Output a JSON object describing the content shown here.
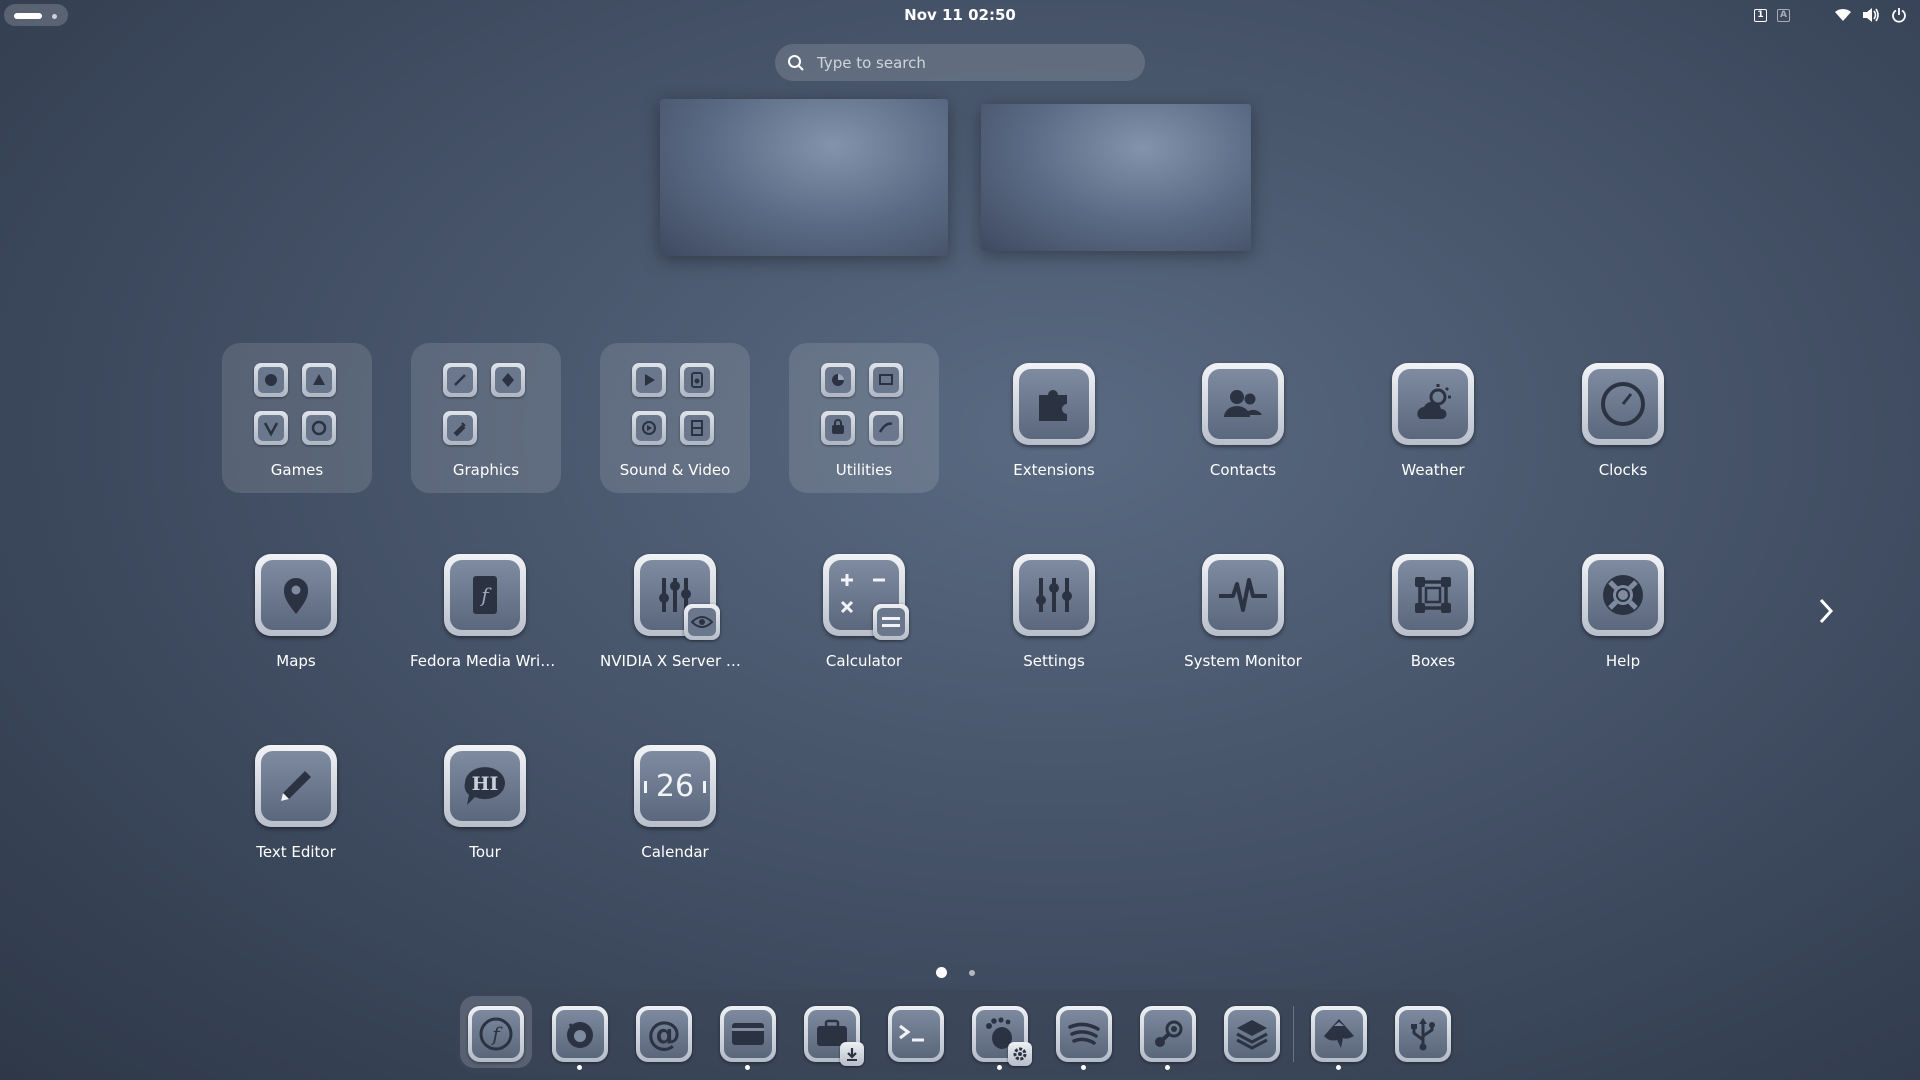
{
  "topbar": {
    "datetime": "Nov 11  02:50",
    "keyboard_indicators": [
      "1",
      "A"
    ]
  },
  "search": {
    "placeholder": "Type to search"
  },
  "folders": [
    {
      "label": "Games",
      "icon": "games-folder-icon"
    },
    {
      "label": "Graphics",
      "icon": "graphics-folder-icon"
    },
    {
      "label": "Sound & Video",
      "icon": "sound-video-folder-icon"
    },
    {
      "label": "Utilities",
      "icon": "utilities-folder-icon"
    }
  ],
  "apps": [
    {
      "label": "Extensions",
      "icon": "puzzle-icon"
    },
    {
      "label": "Contacts",
      "icon": "contacts-icon"
    },
    {
      "label": "Weather",
      "icon": "weather-icon"
    },
    {
      "label": "Clocks",
      "icon": "clock-icon"
    },
    {
      "label": "Maps",
      "icon": "map-pin-icon"
    },
    {
      "label": "Fedora Media Writer",
      "icon": "fedora-media-writer-icon"
    },
    {
      "label": "NVIDIA X Server Settings",
      "icon": "nvidia-settings-icon"
    },
    {
      "label": "Calculator",
      "icon": "calculator-icon"
    },
    {
      "label": "Settings",
      "icon": "settings-sliders-icon"
    },
    {
      "label": "System Monitor",
      "icon": "pulse-icon"
    },
    {
      "label": "Boxes",
      "icon": "boxes-icon"
    },
    {
      "label": "Help",
      "icon": "lifebuoy-icon"
    },
    {
      "label": "Text Editor",
      "icon": "pencil-icon"
    },
    {
      "label": "Tour",
      "icon": "speech-bubble-icon",
      "glyph": "HI"
    },
    {
      "label": "Calendar",
      "icon": "calendar-icon",
      "glyph": "26"
    }
  ],
  "pager": {
    "pages": 2,
    "current": 1
  },
  "dock": [
    {
      "name": "fedora-launcher",
      "icon": "fedora-icon",
      "active": true,
      "running": false
    },
    {
      "name": "firefox",
      "icon": "firefox-icon",
      "running": true
    },
    {
      "name": "mail",
      "icon": "at-sign-icon",
      "running": false
    },
    {
      "name": "window",
      "icon": "window-icon",
      "running": true
    },
    {
      "name": "software",
      "icon": "briefcase-download-icon",
      "running": false
    },
    {
      "name": "terminal",
      "icon": "terminal-icon",
      "running": false
    },
    {
      "name": "gnome-tweaks",
      "icon": "gnome-foot-icon",
      "running": true
    },
    {
      "name": "spotify",
      "icon": "spotify-icon",
      "running": true
    },
    {
      "name": "steam",
      "icon": "steam-icon",
      "running": true
    },
    {
      "name": "layers",
      "icon": "layers-icon",
      "running": false
    },
    {
      "name": "inkscape",
      "icon": "inkscape-icon",
      "running": true
    },
    {
      "name": "usb-tool",
      "icon": "usb-icon",
      "running": false
    }
  ]
}
